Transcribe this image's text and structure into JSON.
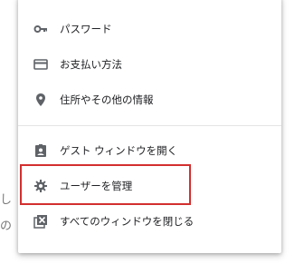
{
  "menu": {
    "items": [
      {
        "label": "パスワード",
        "icon": "key-icon"
      },
      {
        "label": "お支払い方法",
        "icon": "credit-card-icon"
      },
      {
        "label": "住所やその他の情報",
        "icon": "location-pin-icon"
      },
      {
        "label": "ゲスト ウィンドウを開く",
        "icon": "guest-badge-icon"
      },
      {
        "label": "ユーザーを管理",
        "icon": "gear-icon"
      },
      {
        "label": "すべてのウィンドウを閉じる",
        "icon": "close-box-icon"
      }
    ]
  },
  "background": {
    "fragment_1": "し",
    "fragment_2": "の"
  },
  "colors": {
    "highlight": "#d32f2f",
    "icon": "#5f6368",
    "text": "#202124"
  }
}
